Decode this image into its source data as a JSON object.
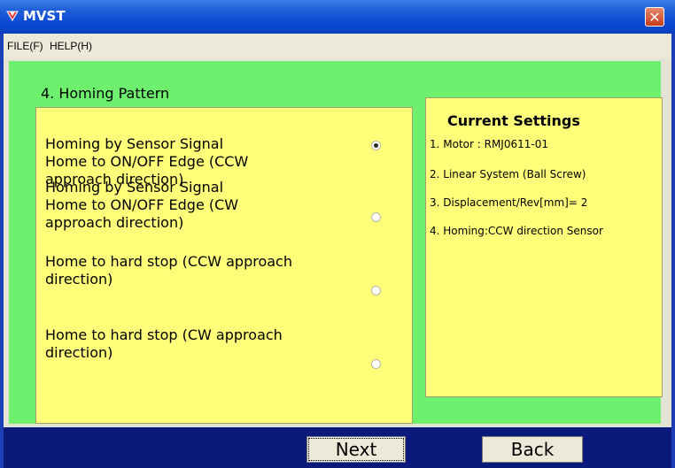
{
  "window": {
    "title": "MVST",
    "close_glyph": "✕"
  },
  "menu": {
    "items": [
      "FILE(F)",
      "HELP(H)"
    ]
  },
  "page": {
    "section_title": "4. Homing Pattern"
  },
  "options": [
    {
      "label": "Homing by Sensor Signal\nHome to ON/OFF Edge (CCW\napproach direction)",
      "selected": true
    },
    {
      "label": "Homing by Sensor Signal\nHome to ON/OFF Edge (CW\napproach direction)",
      "selected": false
    },
    {
      "label": "Home to hard stop (CCW approach\ndirection)",
      "selected": false
    },
    {
      "label": "Home to hard stop (CW approach\ndirection)",
      "selected": false
    }
  ],
  "settings": {
    "title": "Current Settings",
    "lines": [
      "1. Motor : RMJ0611-01",
      "2. Linear System (Ball Screw)",
      "3. Displacement/Rev[mm]= 2",
      "4. Homing:CCW direction Sensor"
    ]
  },
  "buttons": {
    "next_label": "Next",
    "back_label": "Back"
  },
  "colors": {
    "panel_green": "#6ef06e",
    "panel_yellow": "#ffff7a",
    "titlebar_blue": "#0a49d1",
    "footer_navy": "#0a1a7a"
  }
}
